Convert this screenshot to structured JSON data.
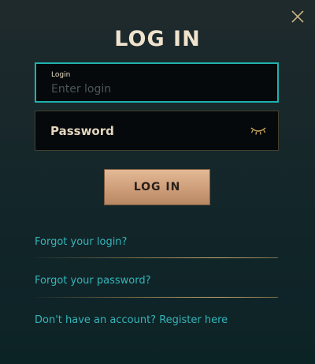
{
  "dialog": {
    "title": "LOG IN",
    "close_icon": "close-icon"
  },
  "login_field": {
    "label": "Login",
    "placeholder": "Enter login",
    "value": ""
  },
  "password_field": {
    "placeholder": "Password",
    "value": "",
    "toggle_icon": "eye-closed-icon"
  },
  "submit": {
    "label": "LOG IN"
  },
  "links": {
    "forgot_login": "Forgot your login?",
    "forgot_password": "Forgot your password?",
    "register": "Don't have an account? Register here"
  },
  "colors": {
    "accent_teal": "#1fb1ae",
    "link": "#34b5b9",
    "button_gold": "#cfa07b",
    "title": "#efe3cd"
  }
}
